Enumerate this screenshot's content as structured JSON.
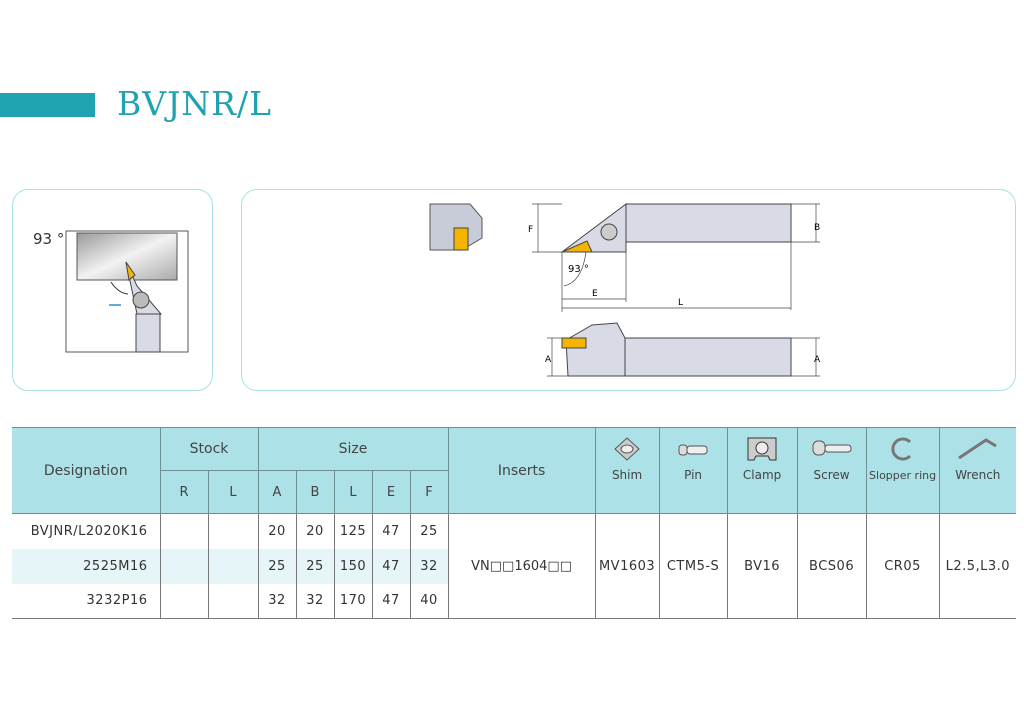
{
  "header": {
    "title": "BVJNR/L",
    "accent": "#1fa3b1"
  },
  "diagram1": {
    "angle": "93 °"
  },
  "diagram2": {
    "labels": {
      "F": "F",
      "B": "B",
      "E": "E",
      "L": "L",
      "A": "A",
      "angle": "93 °"
    }
  },
  "table": {
    "headers": {
      "designation": "Designation",
      "stock": "Stock",
      "size": "Size",
      "inserts": "Inserts",
      "stock_cols": [
        "R",
        "L"
      ],
      "size_cols": [
        "A",
        "B",
        "L",
        "E",
        "F"
      ],
      "accessories": [
        {
          "label": "Shim",
          "icon": "shim-icon"
        },
        {
          "label": "Pin",
          "icon": "pin-icon"
        },
        {
          "label": "Clamp",
          "icon": "clamp-icon"
        },
        {
          "label": "Screw",
          "icon": "screw-icon"
        },
        {
          "label": "Slopper ring",
          "icon": "ring-icon"
        },
        {
          "label": "Wrench",
          "icon": "wrench-icon"
        }
      ]
    },
    "rows": [
      {
        "designation": "BVJNR/L2020K16",
        "R": "",
        "L": "",
        "size": [
          "20",
          "20",
          "125",
          "47",
          "25"
        ]
      },
      {
        "designation": "2525M16",
        "R": "",
        "L": "",
        "size": [
          "25",
          "25",
          "150",
          "47",
          "32"
        ]
      },
      {
        "designation": "3232P16",
        "R": "",
        "L": "",
        "size": [
          "32",
          "32",
          "170",
          "47",
          "40"
        ]
      }
    ],
    "shared": {
      "insert": "VN□□1604□□",
      "shim": "MV1603",
      "pin": "CTM5-S",
      "clamp": "BV16",
      "screw": "BCS06",
      "ring": "CR05",
      "wrench": "L2.5,L3.0"
    }
  }
}
